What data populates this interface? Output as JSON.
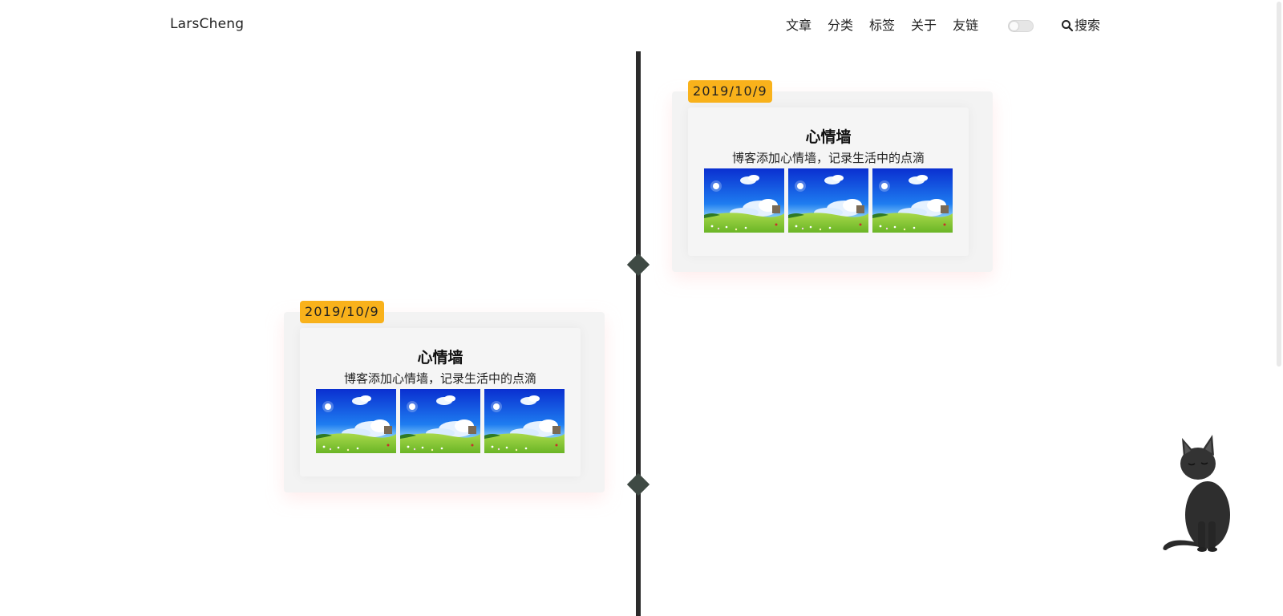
{
  "header": {
    "brand": "LarsCheng",
    "nav": [
      {
        "label": "文章"
      },
      {
        "label": "分类"
      },
      {
        "label": "标签"
      },
      {
        "label": "关于"
      },
      {
        "label": "友链"
      }
    ],
    "theme_toggle": {
      "state": "off",
      "icon": "toggle-switch"
    },
    "search": {
      "label": "搜索",
      "icon": "search-icon"
    }
  },
  "timeline": {
    "entries": [
      {
        "date": "2019/10/9",
        "title": "心情墙",
        "description": "博客添加心情墙，记录生活中的点滴",
        "photos": [
          "landscape-photo",
          "landscape-photo",
          "landscape-photo"
        ],
        "side": "right"
      },
      {
        "date": "2019/10/9",
        "title": "心情墙",
        "description": "博客添加心情墙，记录生活中的点滴",
        "photos": [
          "landscape-photo",
          "landscape-photo",
          "landscape-photo"
        ],
        "side": "left"
      }
    ]
  },
  "colors": {
    "date_badge": "#f9b21b",
    "timeline_line": "#2b2b2b",
    "timeline_marker": "#3f4a44",
    "card_bg": "#f3f3f3"
  },
  "mascot": {
    "icon": "black-cat-icon"
  }
}
